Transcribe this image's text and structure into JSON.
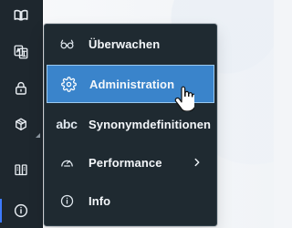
{
  "rail": {
    "items": [
      {
        "icon": "book-icon"
      },
      {
        "icon": "translate-icon"
      },
      {
        "icon": "lock-icon"
      },
      {
        "icon": "box-icon"
      },
      {
        "icon": "server-icon"
      },
      {
        "icon": "info-icon"
      }
    ]
  },
  "menu": {
    "items": [
      {
        "label": "Überwachen",
        "icon": "glasses-icon"
      },
      {
        "label": "Administration",
        "icon": "gear-icon"
      },
      {
        "label": "Synonymdefinitionen",
        "icon": "abc-icon",
        "icon_text": "abc"
      },
      {
        "label": "Performance",
        "icon": "speedometer-icon"
      },
      {
        "label": "Info",
        "icon": "info-icon"
      }
    ]
  },
  "colors": {
    "rail_bg": "#1e272e",
    "menu_bg": "#1f2a31",
    "active_bg": "#3a84cb",
    "active_border": "#9bc9ef",
    "text": "#f4f7fa",
    "icon": "#dfe7ee"
  }
}
